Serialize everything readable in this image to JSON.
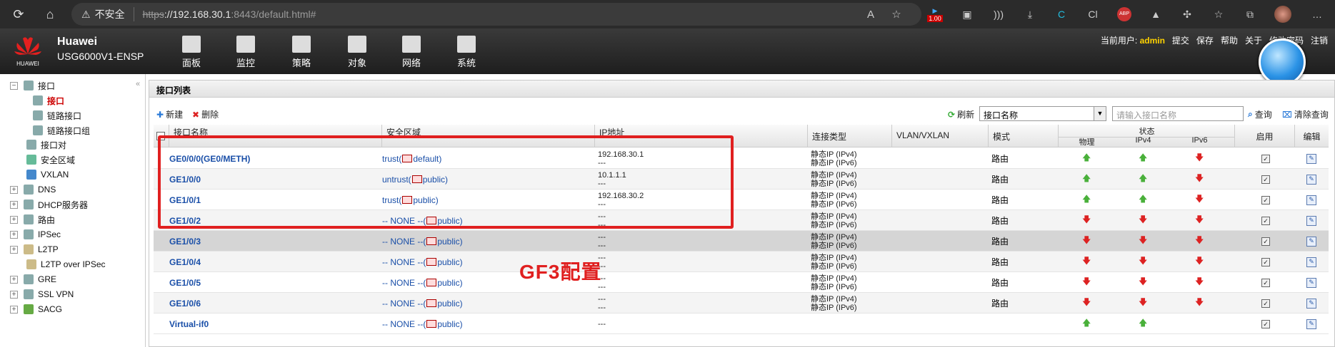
{
  "browser": {
    "insecure_label": "不安全",
    "url_scheme": "https",
    "url_host": "://192.168.30.1",
    "url_rest": ":8443/default.html#",
    "ext_badge": "1.00"
  },
  "app": {
    "vendor": "Huawei",
    "product": "USG6000V1-ENSP",
    "logo_text": "HUAWEI",
    "nav": [
      "面板",
      "监控",
      "策略",
      "对象",
      "网络",
      "系统"
    ],
    "current_user_label": "当前用户:",
    "current_user": "admin",
    "links": [
      "提交",
      "保存",
      "帮助",
      "关于",
      "修改密码",
      "注销"
    ]
  },
  "sidebar": {
    "items": [
      {
        "label": "接口",
        "level": 0,
        "expander": "−"
      },
      {
        "label": "接口",
        "level": 1,
        "selected": true
      },
      {
        "label": "链路接口",
        "level": 1
      },
      {
        "label": "链路接口组",
        "level": 1
      },
      {
        "label": "接口对",
        "level": 0
      },
      {
        "label": "安全区域",
        "level": 0
      },
      {
        "label": "VXLAN",
        "level": 0
      },
      {
        "label": "DNS",
        "level": 0,
        "expander": "+"
      },
      {
        "label": "DHCP服务器",
        "level": 0,
        "expander": "+"
      },
      {
        "label": "路由",
        "level": 0,
        "expander": "+"
      },
      {
        "label": "IPSec",
        "level": 0,
        "expander": "+"
      },
      {
        "label": "L2TP",
        "level": 0,
        "expander": "+"
      },
      {
        "label": "L2TP over IPSec",
        "level": 0
      },
      {
        "label": "GRE",
        "level": 0,
        "expander": "+"
      },
      {
        "label": "SSL VPN",
        "level": 0,
        "expander": "+"
      },
      {
        "label": "SACG",
        "level": 0,
        "expander": "+"
      }
    ]
  },
  "main": {
    "title": "接口列表",
    "toolbar": {
      "new": "新建",
      "delete": "删除",
      "refresh": "刷新",
      "filter_select": "接口名称",
      "search_placeholder": "请输入接口名称",
      "query": "查询",
      "clear_query": "清除查询"
    },
    "headers": {
      "name": "接口名称",
      "zone": "安全区域",
      "ip": "IP地址",
      "conn_type": "连接类型",
      "vlan": "VLAN/VXLAN",
      "mode": "模式",
      "status": "状态",
      "physical": "物理",
      "ipv4": "IPv4",
      "ipv6": "IPv6",
      "enable": "启用",
      "edit": "编辑"
    },
    "rows": [
      {
        "name": "GE0/0/0(GE0/METH)",
        "zone": "trust(",
        "vsys": "default)",
        "ip1": "192.168.30.1",
        "ip2": "---",
        "t1": "静态IP (IPv4)",
        "t2": "静态IP (IPv6)",
        "mode": "路由",
        "phy": "up",
        "v4": "up",
        "v6": "down"
      },
      {
        "name": "GE1/0/0",
        "zone": "untrust(",
        "vsys": "public)",
        "ip1": "10.1.1.1",
        "ip2": "---",
        "t1": "静态IP (IPv4)",
        "t2": "静态IP (IPv6)",
        "mode": "路由",
        "phy": "up",
        "v4": "up",
        "v6": "down"
      },
      {
        "name": "GE1/0/1",
        "zone": "trust(",
        "vsys": "public)",
        "ip1": "192.168.30.2",
        "ip2": "---",
        "t1": "静态IP (IPv4)",
        "t2": "静态IP (IPv6)",
        "mode": "路由",
        "phy": "up",
        "v4": "up",
        "v6": "down"
      },
      {
        "name": "GE1/0/2",
        "zone": "-- NONE --(",
        "vsys": "public)",
        "ip1": "---",
        "ip2": "---",
        "t1": "静态IP (IPv4)",
        "t2": "静态IP (IPv6)",
        "mode": "路由",
        "phy": "down",
        "v4": "down",
        "v6": "down"
      },
      {
        "name": "GE1/0/3",
        "zone": "-- NONE --(",
        "vsys": "public)",
        "ip1": "---",
        "ip2": "---",
        "t1": "静态IP (IPv4)",
        "t2": "静态IP (IPv6)",
        "mode": "路由",
        "phy": "down",
        "v4": "down",
        "v6": "down"
      },
      {
        "name": "GE1/0/4",
        "zone": "-- NONE --(",
        "vsys": "public)",
        "ip1": "---",
        "ip2": "---",
        "t1": "静态IP (IPv4)",
        "t2": "静态IP (IPv6)",
        "mode": "路由",
        "phy": "down",
        "v4": "down",
        "v6": "down"
      },
      {
        "name": "GE1/0/5",
        "zone": "-- NONE --(",
        "vsys": "public)",
        "ip1": "---",
        "ip2": "---",
        "t1": "静态IP (IPv4)",
        "t2": "静态IP (IPv6)",
        "mode": "路由",
        "phy": "down",
        "v4": "down",
        "v6": "down"
      },
      {
        "name": "GE1/0/6",
        "zone": "-- NONE --(",
        "vsys": "public)",
        "ip1": "---",
        "ip2": "---",
        "t1": "静态IP (IPv4)",
        "t2": "静态IP (IPv6)",
        "mode": "路由",
        "phy": "down",
        "v4": "down",
        "v6": "down"
      },
      {
        "name": "Virtual-if0",
        "zone": "-- NONE --(",
        "vsys": "public)",
        "ip1": "---",
        "ip2": "",
        "t1": "",
        "t2": "",
        "mode": "",
        "phy": "up",
        "v4": "up",
        "v6": ""
      }
    ]
  },
  "annotation": {
    "text": "GF3配置",
    "color": "#e02020"
  }
}
